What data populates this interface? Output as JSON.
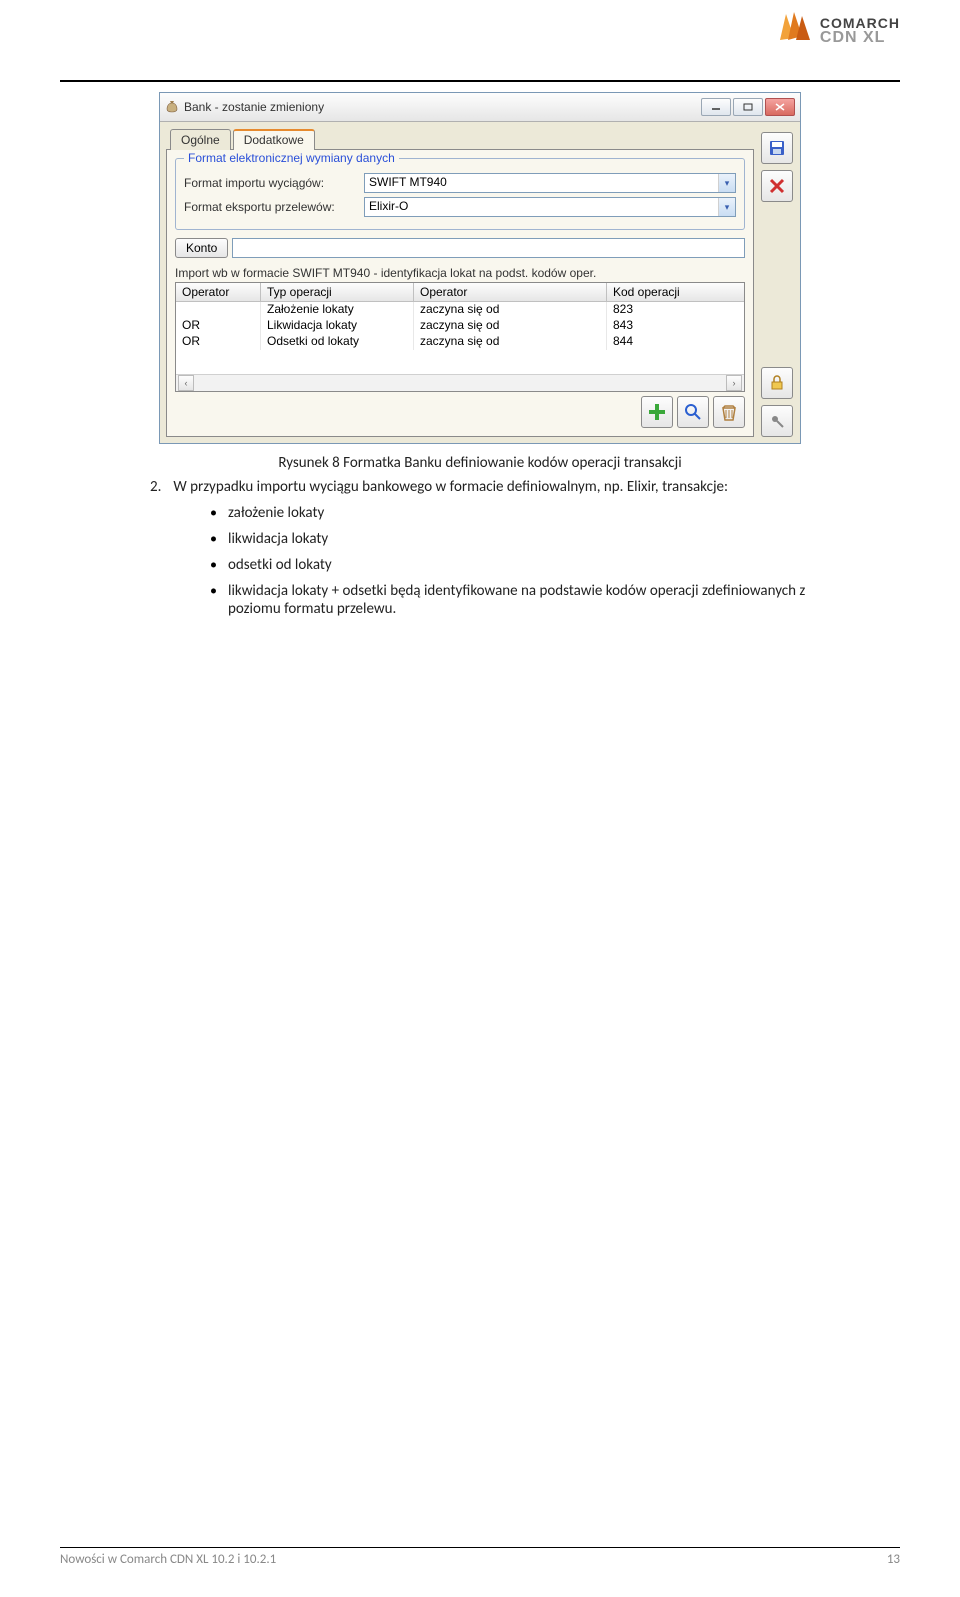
{
  "logo": {
    "brand": "COMARCH",
    "product": "CDN XL"
  },
  "window": {
    "title": "Bank - zostanie zmieniony",
    "tabs": {
      "general": "Ogólne",
      "additional": "Dodatkowe"
    },
    "group_title": "Format elektronicznej wymiany danych",
    "labels": {
      "import_format": "Format importu wyciągów:",
      "export_format": "Format eksportu przelewów:"
    },
    "values": {
      "import_format": "SWIFT MT940",
      "export_format": "Elixir-O"
    },
    "konto_button": "Konto",
    "import_desc": "Import wb w formacie SWIFT MT940 - identyfikacja lokat na podst. kodów oper.",
    "grid": {
      "headers": {
        "op1": "Operator",
        "type": "Typ operacji",
        "op2": "Operator",
        "code": "Kod operacji"
      },
      "rows": [
        {
          "op1": "",
          "type": "Założenie lokaty",
          "op2": "zaczyna się od",
          "code": "823"
        },
        {
          "op1": "OR",
          "type": "Likwidacja lokaty",
          "op2": "zaczyna się od",
          "code": "843"
        },
        {
          "op1": "OR",
          "type": "Odsetki od lokaty",
          "op2": "zaczyna się od",
          "code": "844"
        }
      ]
    }
  },
  "caption": "Rysunek 8 Formatka Banku definiowanie kodów operacji transakcji",
  "para_lead": "2.",
  "para_text": "W przypadku importu wyciągu bankowego w formacie definiowalnym, np. Elixir, transakcje:",
  "bullets": [
    "założenie lokaty",
    "likwidacja lokaty",
    "odsetki od lokaty",
    "likwidacja lokaty + odsetki będą identyfikowane na podstawie kodów operacji zdefiniowanych z poziomu formatu przelewu."
  ],
  "footer": {
    "left": "Nowości w Comarch CDN XL 10.2 i 10.2.1",
    "page": "13"
  }
}
